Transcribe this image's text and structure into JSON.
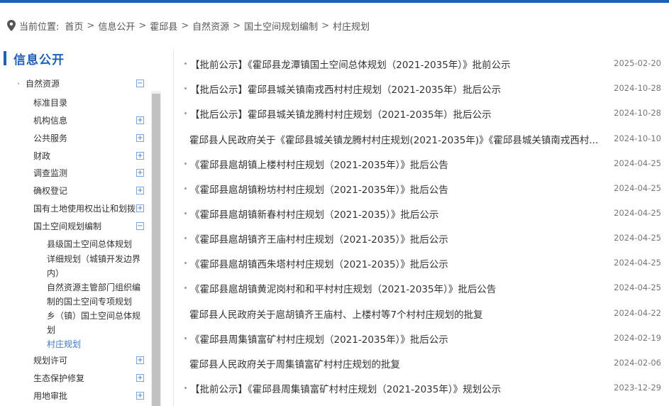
{
  "breadcrumb": {
    "prefix": "当前位置:",
    "items": [
      "首页",
      "信息公开",
      "霍邱县",
      "自然资源",
      "国土空间规划编制",
      "村庄规划"
    ],
    "separator": ">"
  },
  "sidebar": {
    "title": "信息公开",
    "root": {
      "label": "自然资源",
      "toggle": "−"
    },
    "items": [
      {
        "label": "标准目录",
        "toggle": ""
      },
      {
        "label": "机构信息",
        "toggle": "+"
      },
      {
        "label": "公共服务",
        "toggle": "+"
      },
      {
        "label": "财政",
        "toggle": "+"
      },
      {
        "label": "调查监测",
        "toggle": "+"
      },
      {
        "label": "确权登记",
        "toggle": "+"
      },
      {
        "label": "国有土地使用权出让和划拨",
        "toggle": "+"
      },
      {
        "label": "国土空间规划编制",
        "toggle": "−"
      },
      {
        "label": "规划许可",
        "toggle": "+"
      },
      {
        "label": "生态保护修复",
        "toggle": "+"
      },
      {
        "label": "用地审批",
        "toggle": "+"
      }
    ],
    "subitems": [
      "县级国土空间总体规划",
      "详细规划（城镇开发边界内）",
      "自然资源主管部门组织编制的国土空间专项规划",
      "乡（镇）国土空间总体规划",
      "村庄规划"
    ]
  },
  "list": [
    {
      "title": "【批前公示】《霍邱县龙潭镇国土空间总体规划（2021-2035年）》批前公示",
      "date": "2025-02-20",
      "dot": true
    },
    {
      "title": "【批后公示】霍邱县城关镇南戎西村村庄规划（2021-2035年）批后公示",
      "date": "2024-10-28",
      "dot": true
    },
    {
      "title": "【批后公示】霍邱县城关镇龙腾村村庄规划（2021-2035年）批后公示",
      "date": "2024-10-28",
      "dot": true
    },
    {
      "title": "霍邱县人民政府关于《霍邱县城关镇龙腾村村庄规划(2021-2035年)》《霍邱县城关镇南戎西村...",
      "date": "2024-10-10",
      "dot": false
    },
    {
      "title": "《霍邱县扈胡镇上楼村村庄规划（2021-2035年）》批后公告",
      "date": "2024-04-25",
      "dot": true
    },
    {
      "title": "《霍邱县扈胡镇粉坊村村庄规划（2021-2035年）》批后公告",
      "date": "2024-04-25",
      "dot": true
    },
    {
      "title": "《霍邱县扈胡镇新春村村庄规划（2021-2035）》批后公示",
      "date": "2024-04-25",
      "dot": true
    },
    {
      "title": "《霍邱县扈胡镇齐王庙村村庄规划（2021-2035）》批后公示",
      "date": "2024-04-25",
      "dot": true
    },
    {
      "title": "《霍邱县扈胡镇西朱塔村村庄规划（2021-2035）》批后公示",
      "date": "2024-04-25",
      "dot": true
    },
    {
      "title": "《霍邱县扈胡镇黄泥岗村和和平村村庄规划（2021-2035年）》批后公告",
      "date": "2024-04-25",
      "dot": true
    },
    {
      "title": "霍邱县人民政府关于扈胡镇齐王庙村、上楼村等7个村村庄规划的批复",
      "date": "2024-04-22",
      "dot": false
    },
    {
      "title": "《霍邱县周集镇富矿村村庄规划（2021-2035年）》批后公示",
      "date": "2024-02-19",
      "dot": true
    },
    {
      "title": "霍邱县人民政府关于周集镇富矿村村庄规划的批复",
      "date": "2024-02-06",
      "dot": false
    },
    {
      "title": "【批前公示】《霍邱县周集镇富矿村村庄规划（2021-2035年）》规划公示",
      "date": "2023-12-29",
      "dot": true
    }
  ]
}
